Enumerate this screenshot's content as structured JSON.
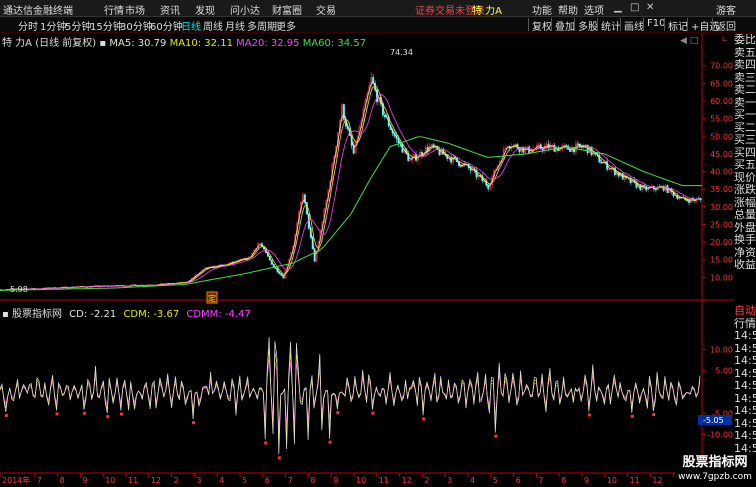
{
  "title_bar": {
    "app_name": "通达信金融终端",
    "menus": [
      "行情",
      "市场",
      "资讯",
      "发现",
      "问小达",
      "财富圈",
      "交易"
    ],
    "notice": "证券交易未登录",
    "stock": "特 力A",
    "right_menus": [
      "功能",
      "帮助",
      "选项"
    ],
    "guest": "游客"
  },
  "toolbar": {
    "periods": [
      "分时",
      "1分钟",
      "5分钟",
      "15分钟",
      "30分钟",
      "60分钟",
      "日线",
      "周线",
      "月线",
      "多周期",
      "更多"
    ],
    "active_period": "日线",
    "right_buttons": [
      "复权",
      "叠加",
      "多股",
      "统计",
      "画线",
      "F10",
      "标记",
      "+自选",
      "返回"
    ]
  },
  "main_legend": {
    "name": "特 力A",
    "mode": "(日线 前复权)",
    "ma": [
      {
        "label": "MA5: 30.79",
        "color": "#e0e0e0"
      },
      {
        "label": "MA10: 32.11",
        "color": "#e8e800"
      },
      {
        "label": "MA20: 32.95",
        "color": "#ff40ff"
      },
      {
        "label": "MA60: 34.57",
        "color": "#40e040"
      }
    ]
  },
  "indicator_legend": {
    "name": "股票指标网",
    "cd": "CD: -2.21",
    "cdm": "CDM: -3.67",
    "cdmm": "CDMM: -4.47"
  },
  "marks": {
    "high": "74.34",
    "low": "5.98",
    "ding": "定",
    "indicator_current": "-5.05",
    "top_right": "L."
  },
  "chart_data": [
    {
      "type": "candlestick",
      "title": "特 力A (日线 前复权)",
      "y_ticks": [
        "70.00",
        "65.00",
        "60.00",
        "55.00",
        "50.00",
        "45.00",
        "40.00",
        "35.00",
        "30.00",
        "25.00",
        "20.00",
        "15.00",
        "10.00"
      ],
      "ylim": [
        5,
        77
      ],
      "x_index_range": [
        0,
        720
      ],
      "close_path": [
        [
          0,
          6.5
        ],
        [
          40,
          6.8
        ],
        [
          80,
          7.3
        ],
        [
          120,
          7.6
        ],
        [
          160,
          7.9
        ],
        [
          190,
          8.5
        ],
        [
          210,
          12.5
        ],
        [
          230,
          13.5
        ],
        [
          255,
          15.5
        ],
        [
          265,
          20.0
        ],
        [
          280,
          13.0
        ],
        [
          290,
          10.0
        ],
        [
          300,
          19.0
        ],
        [
          310,
          34.0
        ],
        [
          322,
          14.5
        ],
        [
          335,
          33.0
        ],
        [
          350,
          58.0
        ],
        [
          362,
          45.0
        ],
        [
          380,
          66.0
        ],
        [
          390,
          58.0
        ],
        [
          405,
          49.5
        ],
        [
          420,
          43.0
        ],
        [
          440,
          47.0
        ],
        [
          460,
          44.0
        ],
        [
          480,
          41.0
        ],
        [
          500,
          36.0
        ],
        [
          520,
          48.0
        ],
        [
          540,
          46.0
        ],
        [
          560,
          47.0
        ],
        [
          580,
          46.5
        ],
        [
          600,
          47.0
        ],
        [
          615,
          43.0
        ],
        [
          640,
          38.0
        ],
        [
          660,
          35.0
        ],
        [
          680,
          35.5
        ],
        [
          700,
          32.0
        ]
      ],
      "ma60_path": [
        [
          0,
          6.3
        ],
        [
          120,
          7.0
        ],
        [
          190,
          8.0
        ],
        [
          250,
          11.0
        ],
        [
          300,
          14.0
        ],
        [
          330,
          18.0
        ],
        [
          360,
          28.0
        ],
        [
          380,
          38.0
        ],
        [
          400,
          47.0
        ],
        [
          430,
          50.0
        ],
        [
          460,
          48.0
        ],
        [
          500,
          44.0
        ],
        [
          540,
          45.0
        ],
        [
          580,
          47.0
        ],
        [
          620,
          45.0
        ],
        [
          660,
          40.0
        ],
        [
          700,
          36.0
        ]
      ],
      "series": [
        {
          "name": "MA5",
          "value": 30.79
        },
        {
          "name": "MA10",
          "value": 32.11
        },
        {
          "name": "MA20",
          "value": 32.95
        },
        {
          "name": "MA60",
          "value": 34.57
        }
      ]
    },
    {
      "type": "line",
      "title": "股票指标网",
      "y_ticks": [
        "10.00",
        "5.00",
        "-5.00",
        "-10.00"
      ],
      "ylim": [
        -19,
        19
      ],
      "series": [
        {
          "name": "CD",
          "value": -2.21
        },
        {
          "name": "CDM",
          "value": -3.67
        },
        {
          "name": "CDMM",
          "value": -4.47
        }
      ]
    }
  ],
  "x_axis_labels": [
    "2014年",
    "7",
    "8",
    "9",
    "10",
    "11",
    "12",
    "2",
    "3",
    "4",
    "5",
    "6",
    "7",
    "8",
    "9",
    "10",
    "11",
    "12",
    "2",
    "3",
    "4",
    "5",
    "6",
    "7",
    "8",
    "9",
    "10",
    "11",
    "12",
    "2",
    "3"
  ],
  "side_labels_top": [
    "委比",
    "卖五",
    "卖四",
    "卖三",
    "卖二",
    "卖一",
    "买一",
    "买二",
    "买三",
    "买四",
    "买五",
    "现价",
    "涨跌",
    "涨幅",
    "总量",
    "外盘",
    "换手",
    "净资",
    "收益"
  ],
  "side_labels_bottom": [
    "自动",
    "行情",
    "14:5",
    "14:5",
    "14:5",
    "14:5",
    "14:5",
    "14:5",
    "14:5",
    "14:5",
    "14:5",
    "14:5"
  ],
  "watermark": {
    "line1": "股票指标网",
    "line2": "www.7gpzb.com"
  },
  "colors": {
    "up": "#ff3232",
    "down": "#54fcfc",
    "axis": "#c00000",
    "ma5": "#e0e0e0",
    "ma10": "#e8e800",
    "ma20": "#ff40ff",
    "ma60": "#40e040"
  }
}
